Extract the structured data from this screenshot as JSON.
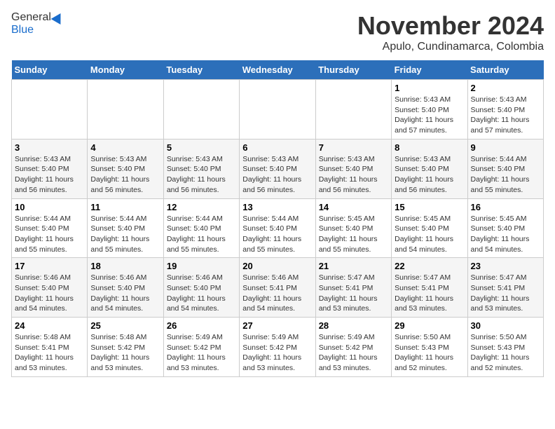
{
  "header": {
    "logo_general": "General",
    "logo_blue": "Blue",
    "month_title": "November 2024",
    "location": "Apulo, Cundinamarca, Colombia"
  },
  "days_of_week": [
    "Sunday",
    "Monday",
    "Tuesday",
    "Wednesday",
    "Thursday",
    "Friday",
    "Saturday"
  ],
  "weeks": [
    [
      {
        "num": "",
        "detail": ""
      },
      {
        "num": "",
        "detail": ""
      },
      {
        "num": "",
        "detail": ""
      },
      {
        "num": "",
        "detail": ""
      },
      {
        "num": "",
        "detail": ""
      },
      {
        "num": "1",
        "detail": "Sunrise: 5:43 AM\nSunset: 5:40 PM\nDaylight: 11 hours and 57 minutes."
      },
      {
        "num": "2",
        "detail": "Sunrise: 5:43 AM\nSunset: 5:40 PM\nDaylight: 11 hours and 57 minutes."
      }
    ],
    [
      {
        "num": "3",
        "detail": "Sunrise: 5:43 AM\nSunset: 5:40 PM\nDaylight: 11 hours and 56 minutes."
      },
      {
        "num": "4",
        "detail": "Sunrise: 5:43 AM\nSunset: 5:40 PM\nDaylight: 11 hours and 56 minutes."
      },
      {
        "num": "5",
        "detail": "Sunrise: 5:43 AM\nSunset: 5:40 PM\nDaylight: 11 hours and 56 minutes."
      },
      {
        "num": "6",
        "detail": "Sunrise: 5:43 AM\nSunset: 5:40 PM\nDaylight: 11 hours and 56 minutes."
      },
      {
        "num": "7",
        "detail": "Sunrise: 5:43 AM\nSunset: 5:40 PM\nDaylight: 11 hours and 56 minutes."
      },
      {
        "num": "8",
        "detail": "Sunrise: 5:43 AM\nSunset: 5:40 PM\nDaylight: 11 hours and 56 minutes."
      },
      {
        "num": "9",
        "detail": "Sunrise: 5:44 AM\nSunset: 5:40 PM\nDaylight: 11 hours and 55 minutes."
      }
    ],
    [
      {
        "num": "10",
        "detail": "Sunrise: 5:44 AM\nSunset: 5:40 PM\nDaylight: 11 hours and 55 minutes."
      },
      {
        "num": "11",
        "detail": "Sunrise: 5:44 AM\nSunset: 5:40 PM\nDaylight: 11 hours and 55 minutes."
      },
      {
        "num": "12",
        "detail": "Sunrise: 5:44 AM\nSunset: 5:40 PM\nDaylight: 11 hours and 55 minutes."
      },
      {
        "num": "13",
        "detail": "Sunrise: 5:44 AM\nSunset: 5:40 PM\nDaylight: 11 hours and 55 minutes."
      },
      {
        "num": "14",
        "detail": "Sunrise: 5:45 AM\nSunset: 5:40 PM\nDaylight: 11 hours and 55 minutes."
      },
      {
        "num": "15",
        "detail": "Sunrise: 5:45 AM\nSunset: 5:40 PM\nDaylight: 11 hours and 54 minutes."
      },
      {
        "num": "16",
        "detail": "Sunrise: 5:45 AM\nSunset: 5:40 PM\nDaylight: 11 hours and 54 minutes."
      }
    ],
    [
      {
        "num": "17",
        "detail": "Sunrise: 5:46 AM\nSunset: 5:40 PM\nDaylight: 11 hours and 54 minutes."
      },
      {
        "num": "18",
        "detail": "Sunrise: 5:46 AM\nSunset: 5:40 PM\nDaylight: 11 hours and 54 minutes."
      },
      {
        "num": "19",
        "detail": "Sunrise: 5:46 AM\nSunset: 5:40 PM\nDaylight: 11 hours and 54 minutes."
      },
      {
        "num": "20",
        "detail": "Sunrise: 5:46 AM\nSunset: 5:41 PM\nDaylight: 11 hours and 54 minutes."
      },
      {
        "num": "21",
        "detail": "Sunrise: 5:47 AM\nSunset: 5:41 PM\nDaylight: 11 hours and 53 minutes."
      },
      {
        "num": "22",
        "detail": "Sunrise: 5:47 AM\nSunset: 5:41 PM\nDaylight: 11 hours and 53 minutes."
      },
      {
        "num": "23",
        "detail": "Sunrise: 5:47 AM\nSunset: 5:41 PM\nDaylight: 11 hours and 53 minutes."
      }
    ],
    [
      {
        "num": "24",
        "detail": "Sunrise: 5:48 AM\nSunset: 5:41 PM\nDaylight: 11 hours and 53 minutes."
      },
      {
        "num": "25",
        "detail": "Sunrise: 5:48 AM\nSunset: 5:42 PM\nDaylight: 11 hours and 53 minutes."
      },
      {
        "num": "26",
        "detail": "Sunrise: 5:49 AM\nSunset: 5:42 PM\nDaylight: 11 hours and 53 minutes."
      },
      {
        "num": "27",
        "detail": "Sunrise: 5:49 AM\nSunset: 5:42 PM\nDaylight: 11 hours and 53 minutes."
      },
      {
        "num": "28",
        "detail": "Sunrise: 5:49 AM\nSunset: 5:42 PM\nDaylight: 11 hours and 53 minutes."
      },
      {
        "num": "29",
        "detail": "Sunrise: 5:50 AM\nSunset: 5:43 PM\nDaylight: 11 hours and 52 minutes."
      },
      {
        "num": "30",
        "detail": "Sunrise: 5:50 AM\nSunset: 5:43 PM\nDaylight: 11 hours and 52 minutes."
      }
    ]
  ]
}
